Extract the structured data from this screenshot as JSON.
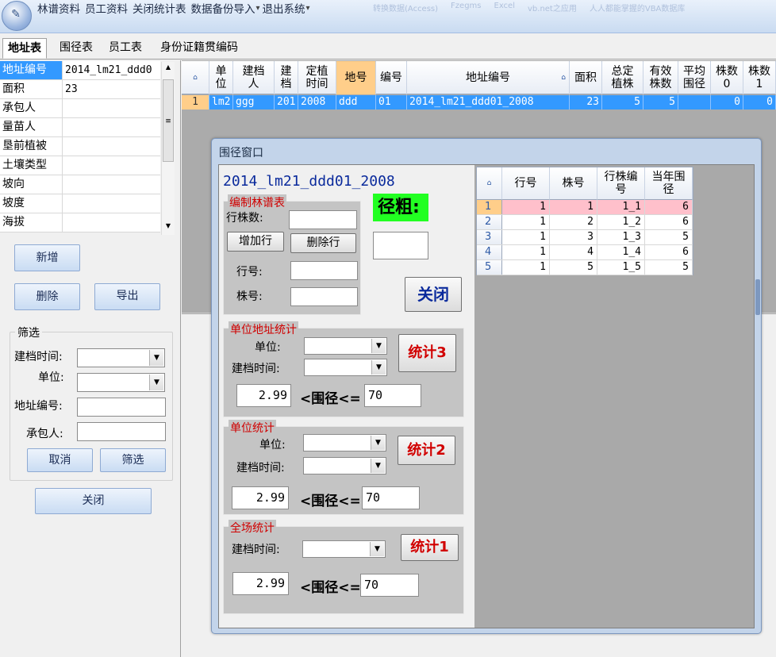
{
  "app": {
    "menu": [
      "林谱资料",
      "员工资料",
      "关闭统计表",
      "数据备份导入",
      "退出系统"
    ],
    "blurred_tabs": [
      "转换数据(Access)",
      "Fzegms",
      "Excel",
      "vb.net之应用",
      "人人都能掌握的VBA数据库"
    ]
  },
  "tabs": [
    "地址表",
    "围径表",
    "员工表",
    "身份证籍贯编码"
  ],
  "props": [
    {
      "k": "地址编号",
      "v": "2014_lm21_ddd0",
      "sel": true
    },
    {
      "k": "面积",
      "v": "23"
    },
    {
      "k": "承包人",
      "v": ""
    },
    {
      "k": "量苗人",
      "v": ""
    },
    {
      "k": "垦前植被",
      "v": ""
    },
    {
      "k": "土壤类型",
      "v": ""
    },
    {
      "k": "坡向",
      "v": ""
    },
    {
      "k": "坡度",
      "v": ""
    },
    {
      "k": "海拔",
      "v": ""
    }
  ],
  "left_buttons": {
    "add": "新增",
    "delete": "删除",
    "export": "导出",
    "close": "关闭"
  },
  "filter": {
    "title": "筛选",
    "build_time_label": "建档时间:",
    "unit_label": "单位:",
    "address_label": "地址编号:",
    "contractor_label": "承包人:",
    "cancel": "取消",
    "apply": "筛选"
  },
  "grid": {
    "headers": [
      "单\n位",
      "建档\n人",
      "建\n档",
      "定植\n时间",
      "地号",
      "编号",
      "地址编号",
      "面积",
      "总定\n植株",
      "有效\n株数",
      "平均\n围径",
      "株数\n0",
      "株数\n1"
    ],
    "row_num": "1",
    "row": [
      "lm2",
      "ggg",
      "201",
      "2008",
      "ddd",
      "01",
      "2014_lm21_ddd01_2008",
      "23",
      "5",
      "5",
      "",
      "0",
      "0"
    ]
  },
  "dialog": {
    "title": "围径窗口",
    "code": "2014_lm21_ddd01_2008",
    "diameter_label": "径粗:",
    "close": "关闭",
    "edit": {
      "title": "编制林谱表",
      "count_label": "行株数:",
      "add_row": "增加行",
      "del_row": "删除行",
      "row_label": "行号:",
      "plant_label": "株号:"
    },
    "unit_addr": {
      "title": "单位地址统计",
      "unit_label": "单位:",
      "time_label": "建档时间:",
      "stat": "统计3",
      "min": "2.99",
      "range_label": "<围径<=",
      "max": "70"
    },
    "unit": {
      "title": "单位统计",
      "unit_label": "单位:",
      "time_label": "建档时间:",
      "stat": "统计2",
      "min": "2.99",
      "range_label": "<围径<=",
      "max": "70"
    },
    "all": {
      "title": "全场统计",
      "time_label": "建档时间:",
      "stat": "统计1",
      "min": "2.99",
      "range_label": "<围径<=",
      "max": "70"
    },
    "table": {
      "headers": [
        "行号",
        "株号",
        "行株编\n号",
        "当年围\n径"
      ],
      "rows": [
        [
          "1",
          "1",
          "1",
          "1_1",
          "6"
        ],
        [
          "2",
          "1",
          "2",
          "1_2",
          "6"
        ],
        [
          "3",
          "1",
          "3",
          "1_3",
          "5"
        ],
        [
          "4",
          "1",
          "4",
          "1_4",
          "6"
        ],
        [
          "5",
          "1",
          "5",
          "1_5",
          "5"
        ]
      ]
    }
  }
}
